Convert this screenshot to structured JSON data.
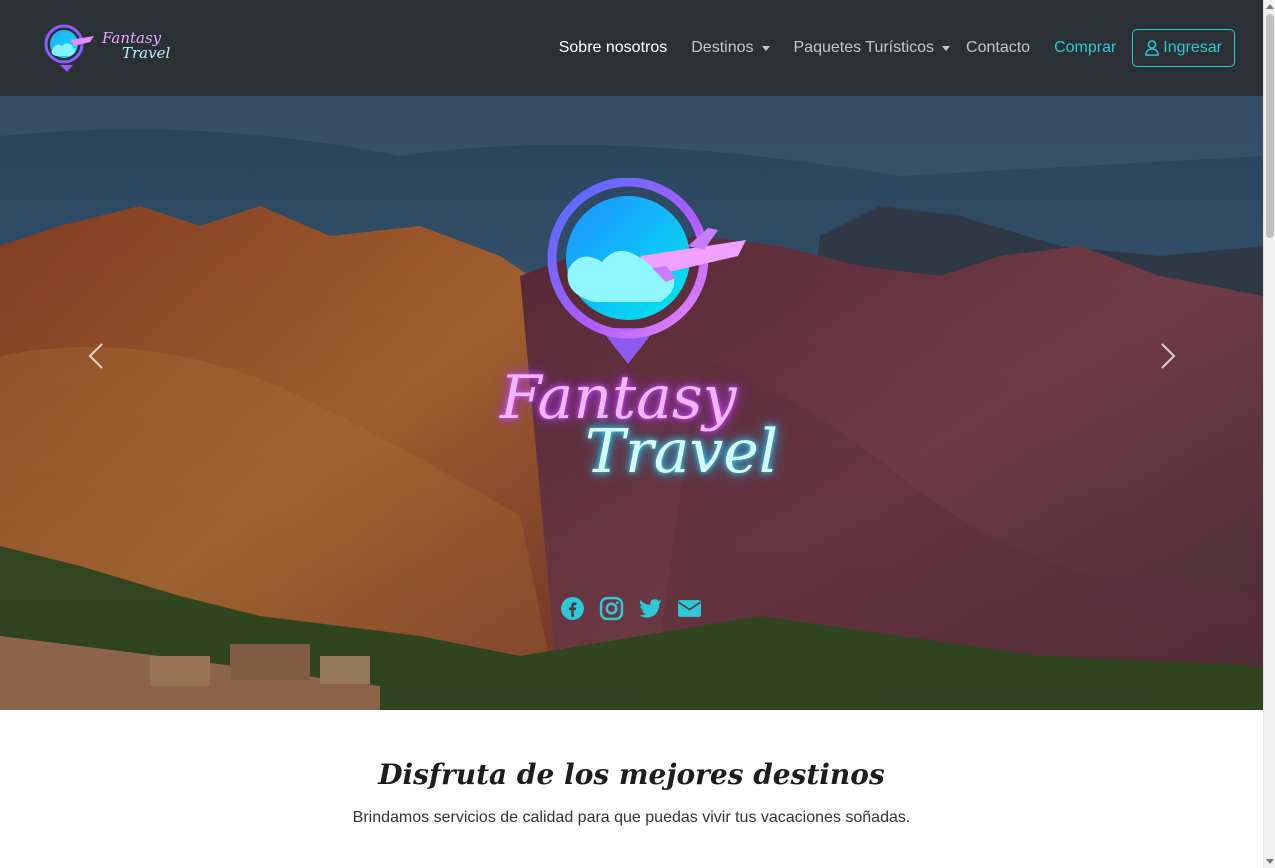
{
  "brand": {
    "name_line1": "Fantasy",
    "name_line2": "Travel"
  },
  "nav": {
    "items": [
      {
        "label": "Sobre nosotros",
        "active": true
      },
      {
        "label": "Destinos",
        "dropdown": true
      },
      {
        "label": "Paquetes Turísticos",
        "dropdown": true
      },
      {
        "label": "Contacto"
      },
      {
        "label": "Comprar"
      }
    ],
    "login_label": "Ingresar"
  },
  "hero": {
    "logo_line1": "Fantasy",
    "logo_line2": "Travel",
    "socials": [
      "facebook-icon",
      "instagram-icon",
      "twitter-icon",
      "envelope-icon"
    ],
    "accent": "#2ec8d8"
  },
  "intro": {
    "title": "Disfruta de los mejores destinos",
    "text": "Brindamos servicios de calidad para que puedas vivir tus vacaciones soñadas."
  },
  "colors": {
    "navbar_bg": "#2b3035",
    "accent": "#2ec8d8",
    "logo_pink": "#e9a6ff",
    "logo_cyan": "#35e0ff"
  }
}
